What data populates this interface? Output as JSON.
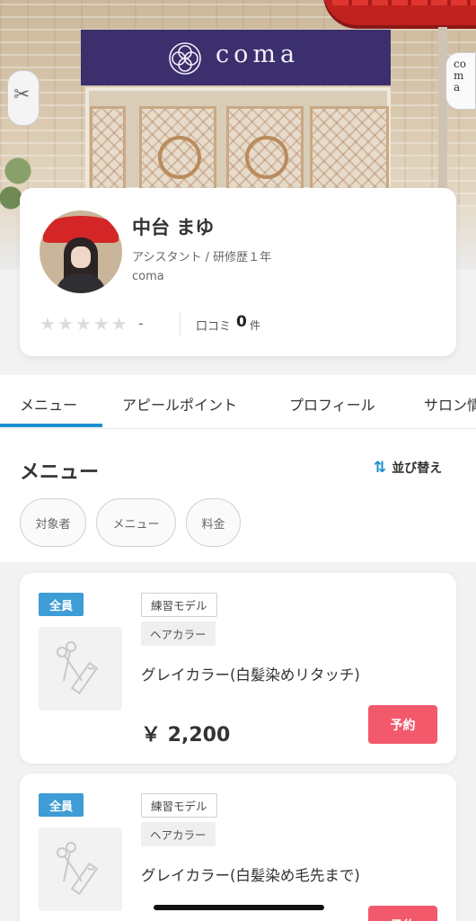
{
  "hero": {
    "brand": "coma",
    "lantern_text": "coma"
  },
  "profile": {
    "name": "中台 まゆ",
    "role": "アシスタント / 研修歴１年",
    "salon": "coma",
    "rating": {
      "stars_filled": 0,
      "stars_total": 5,
      "value": "-"
    },
    "reviews": {
      "label": "口コミ",
      "count": "0",
      "unit": "件"
    }
  },
  "tabs": [
    {
      "label": "メニュー",
      "active": true
    },
    {
      "label": "アピールポイント",
      "active": false
    },
    {
      "label": "プロフィール",
      "active": false
    },
    {
      "label": "サロン情",
      "active": false
    }
  ],
  "menu_section": {
    "title": "メニュー",
    "sort_label": "並び替え",
    "filters": [
      "対象者",
      "メニュー",
      "料金"
    ]
  },
  "menu_items": [
    {
      "badge": "全員",
      "tags": [
        "練習モデル",
        "ヘアカラー"
      ],
      "name": "グレイカラー(白髪染めリタッチ)",
      "price": "￥ 2,200",
      "reserve_label": "予約"
    },
    {
      "badge": "全員",
      "tags": [
        "練習モデル",
        "ヘアカラー"
      ],
      "name": "グレイカラー(白髪染め毛先まで)",
      "price": "",
      "reserve_label": "予約"
    }
  ],
  "colors": {
    "accent": "#1d8fd0",
    "badge": "#3e9cd6",
    "reserve": "#f2596b",
    "noren": "#3b2f6d",
    "awning": "#c0221f"
  }
}
